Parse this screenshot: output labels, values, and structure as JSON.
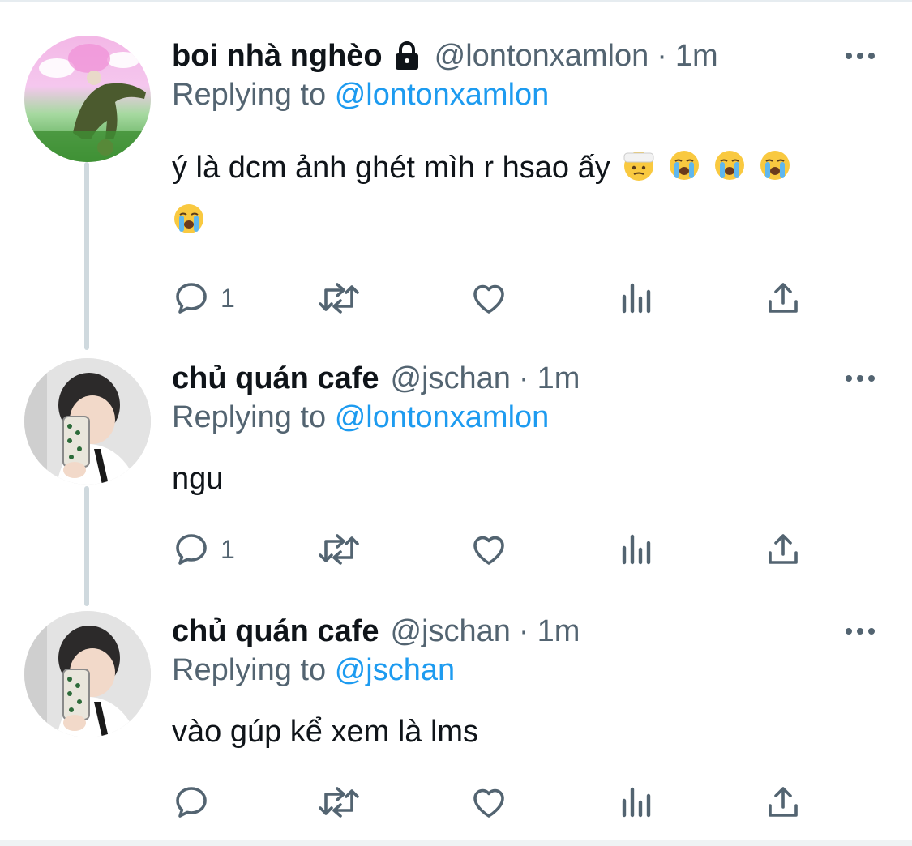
{
  "colors": {
    "link": "#1d9bf0",
    "secondary_text": "#536471",
    "icon": "#536471",
    "primary_text": "#0f1419",
    "thread_line": "#cfd9de"
  },
  "tweets": [
    {
      "display_name": "boi nhà nghèo",
      "protected_icon": "lock-icon",
      "handle": "@lontonxamlon",
      "time": "1m",
      "replying_prefix": "Replying to",
      "replying_to": "@lontonxamlon",
      "text": "ý là dcm ảnh ghét mìh r hsao ấy",
      "emojis": [
        "bandaged-face-emoji",
        "loudly-crying-emoji",
        "loudly-crying-emoji",
        "loudly-crying-emoji",
        "loudly-crying-emoji"
      ],
      "reply_count": "1"
    },
    {
      "display_name": "chủ quán cafe",
      "handle": "@jschan",
      "time": "1m",
      "replying_prefix": "Replying to",
      "replying_to": "@lontonxamlon",
      "text": "ngu",
      "reply_count": "1"
    },
    {
      "display_name": "chủ quán cafe",
      "handle": "@jschan",
      "time": "1m",
      "replying_prefix": "Replying to",
      "replying_to": "@jschan",
      "text": "vào gúp kể xem là lms",
      "reply_count": ""
    }
  ],
  "separator": "·"
}
